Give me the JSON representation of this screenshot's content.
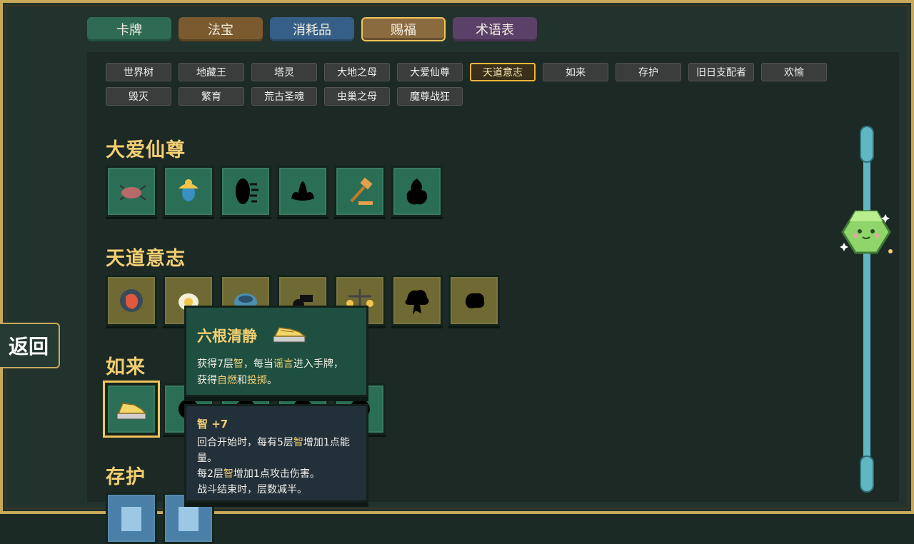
{
  "tabs": [
    {
      "label": "卡牌",
      "color": "#2f6b54"
    },
    {
      "label": "法宝",
      "color": "#7a5a2e"
    },
    {
      "label": "消耗品",
      "color": "#355f86"
    },
    {
      "label": "赐福",
      "color": "#8a6a3f",
      "selected": true
    },
    {
      "label": "术语表",
      "color": "#5b4168"
    }
  ],
  "subtabs": [
    {
      "label": "世界树"
    },
    {
      "label": "地藏王"
    },
    {
      "label": "塔灵"
    },
    {
      "label": "大地之母"
    },
    {
      "label": "大爱仙尊"
    },
    {
      "label": "天道意志",
      "selected": true
    },
    {
      "label": "如来"
    },
    {
      "label": "存护"
    },
    {
      "label": "旧日支配者"
    },
    {
      "label": "欢愉"
    },
    {
      "label": "毁灭"
    },
    {
      "label": "繁育"
    },
    {
      "label": "荒古圣魂"
    },
    {
      "label": "虫巢之母"
    },
    {
      "label": "魔尊战狂"
    }
  ],
  "sections": [
    {
      "title": "大爱仙尊",
      "card_color": "green",
      "cards": [
        "beetle-icon",
        "scarab-icon",
        "dark-portal-icon",
        "silhouette-lotus-icon",
        "gavel-icon",
        "silhouette-flame-icon"
      ]
    },
    {
      "title": "天道意志",
      "card_color": "olive",
      "cards": [
        "fish-icon",
        "egg-icon",
        "orb-icon",
        "cannon-icon",
        "scale-icon",
        "silhouette-explosion-icon",
        "silhouette-splat-icon"
      ]
    },
    {
      "title": "如来",
      "card_color": "green",
      "cards": [
        "golden-shoe-icon",
        "silhouette-icon",
        "silhouette-icon",
        "silhouette-icon",
        "silhouette-icon"
      ]
    },
    {
      "title": "存护",
      "card_color": "blue",
      "cards": [
        "card-icon",
        "card-icon"
      ]
    }
  ],
  "back_label": "返回",
  "tooltip": {
    "title": "六根清静",
    "body_line1_a": "获得7层",
    "body_line1_b": "智",
    "body_line1_c": "，每当",
    "body_line1_d": "谣言",
    "body_line1_e": "进入手牌，",
    "body_line2_a": "获得",
    "body_line2_b": "自燃",
    "body_line2_c": "和",
    "body_line2_d": "投掷",
    "body_line2_e": "。"
  },
  "tooltip2": {
    "title": "智 +7",
    "line1_a": "回合开始时，每有5层",
    "line1_b": "智",
    "line1_c": "增加1点能",
    "line2": "量。",
    "line3_a": "每2层",
    "line3_b": "智",
    "line3_c": "增加1点攻击伤害。",
    "line4": "战斗结束时，层数减半。"
  },
  "colors": {
    "accent": "#f3cf72",
    "frame": "#c8a95a",
    "scroll": "#5fb7c2"
  }
}
